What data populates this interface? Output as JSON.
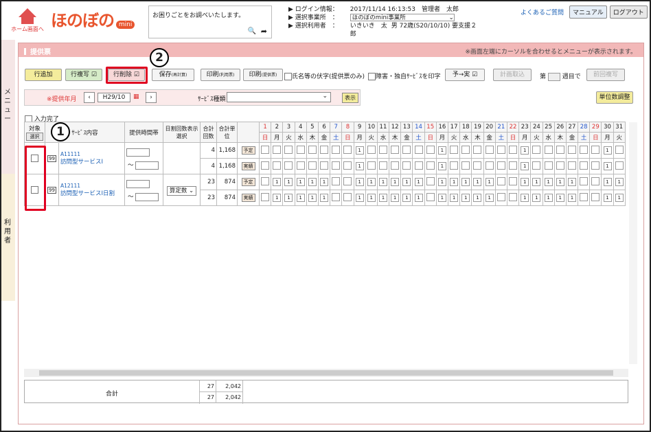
{
  "header": {
    "home_label": "ホーム画面へ",
    "logo_text": "ほのぼの",
    "logo_badge": "mini",
    "help_text": "お困りごとをお調べいたします。",
    "login_label": "ログイン情報：",
    "login_value": "2017/11/14 16:13:53　管理者　太郎",
    "office_label": "選択事業所　：",
    "office_value": "ほのぼのmini事業所",
    "user_label": "選択利用者　：",
    "user_name": "いきいき　太郎",
    "user_detail": "男 72歳(S20/10/10) 要支援２",
    "faq": "よくあるご質問",
    "manual": "マニュアル",
    "logout": "ログアウト"
  },
  "side": {
    "menu": "メニュー",
    "user": "利用者"
  },
  "panel": {
    "title": "提供票",
    "note": "※画面左端にカーソルを合わせるとメニューが表示されます。"
  },
  "toolbar": {
    "add": "行追加",
    "copy": "行複写",
    "delete": "行削除",
    "save": "保存",
    "save_sub": "(再計算)",
    "print1": "印刷",
    "print1_sub": "(利用票)",
    "print2": "印刷",
    "print2_sub": "(提供票)",
    "opt1": "氏名等の伏字(提供票のみ)",
    "opt2": "障害・独自ｻｰﾋﾞｽを印字",
    "plan_to_actual": "予→実",
    "plan_import": "計画取込",
    "week_prefix": "第",
    "week_suffix": "週目で",
    "prev_copy": "前回複写"
  },
  "filter": {
    "month_label": "※提供年月",
    "month_value": "H29/10",
    "service_label": "ｻｰﾋﾞｽ種類",
    "show": "表示",
    "unit_adjust": "単位数調整"
  },
  "complete_label": "入力完了",
  "columns": {
    "target": "対象",
    "select": "選択",
    "content": "ｻｰﾋﾞｽ内容",
    "time": "提供時間帯",
    "daily": "日割回数表示選択",
    "count": "合計回数",
    "units": "合計単位"
  },
  "days": [
    "1",
    "2",
    "3",
    "4",
    "5",
    "6",
    "7",
    "8",
    "9",
    "10",
    "11",
    "12",
    "13",
    "14",
    "15",
    "16",
    "17",
    "18",
    "19",
    "20",
    "21",
    "22",
    "23",
    "24",
    "25",
    "26",
    "27",
    "28",
    "29",
    "30",
    "31"
  ],
  "weekdays": [
    "日",
    "月",
    "火",
    "水",
    "木",
    "金",
    "土",
    "日",
    "月",
    "火",
    "水",
    "木",
    "金",
    "土",
    "日",
    "月",
    "火",
    "水",
    "木",
    "金",
    "土",
    "日",
    "月",
    "火",
    "水",
    "木",
    "金",
    "土",
    "日",
    "月",
    "火"
  ],
  "rows": [
    {
      "code": "A11111",
      "name": "訪問型サービスⅠ",
      "badge": "99",
      "daily": "",
      "plan_label": "予定",
      "actual_label": "実績",
      "plan_count": "4",
      "plan_units": "1,168",
      "actual_count": "4",
      "actual_units": "1,168",
      "plan_days": [
        9,
        16,
        23,
        30
      ],
      "actual_days": [
        9,
        16,
        23,
        30
      ]
    },
    {
      "code": "A12111",
      "name": "訪問型サービスⅠ日割",
      "badge": "99",
      "daily": "算定数",
      "plan_label": "予定",
      "actual_label": "実績",
      "plan_count": "23",
      "plan_units": "874",
      "actual_count": "23",
      "actual_units": "874",
      "plan_days": [
        9,
        10,
        11,
        12,
        13,
        16,
        17,
        18,
        19,
        20,
        23,
        24,
        25,
        26,
        27,
        30,
        31,
        2,
        3,
        4,
        5,
        6,
        14
      ],
      "actual_days": [
        9,
        10,
        11,
        12,
        13,
        16,
        17,
        18,
        19,
        20,
        23,
        24,
        25,
        26,
        27,
        30,
        31,
        2,
        3,
        4,
        5,
        6,
        14
      ]
    }
  ],
  "totals": {
    "label": "合計",
    "count1": "27",
    "units1": "2,042",
    "count2": "27",
    "units2": "2,042"
  },
  "callouts": {
    "one": "1",
    "two": "2"
  },
  "colors": {
    "sunday": "#d33",
    "saturday": "#2255cc",
    "accent": "#e00020"
  }
}
